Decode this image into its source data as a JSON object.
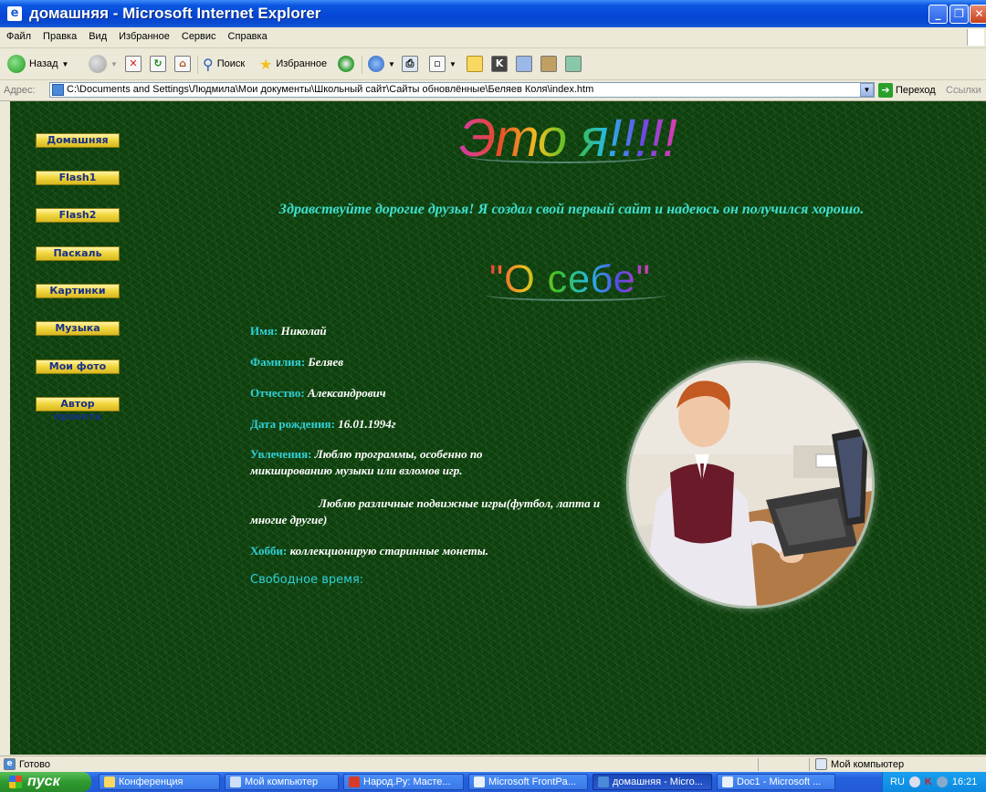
{
  "window": {
    "title": "домашняя - Microsoft Internet Explorer",
    "controls": [
      "minimize",
      "maximize",
      "close"
    ]
  },
  "menu": [
    "Файл",
    "Правка",
    "Вид",
    "Избранное",
    "Сервис",
    "Справка"
  ],
  "toolbar": {
    "back_label": "Назад",
    "search_label": "Поиск",
    "favorites_label": "Избранное"
  },
  "address": {
    "label": "Адрес:",
    "url": "C:\\Documents and Settings\\Людмила\\Мои документы\\Школьный сайт\\Сайты обновлённые\\Беляев Коля\\index.htm",
    "go_label": "Переход",
    "links_label": "Ссылки"
  },
  "page": {
    "nav": [
      "Домашняя",
      "Flash1",
      "Flash2",
      "Паскаль",
      "Картинки",
      "Музыка",
      "Мои фото",
      "Автор проекта"
    ],
    "heading": "Это я!!!!!",
    "greeting": "Здравствуйте дорогие друзья! Я создал свой первый сайт и надеюсь он получился хорошо.",
    "about_heading": "\"О себе\"",
    "fields": {
      "name_label": "Имя:",
      "name_value": "Николай",
      "surname_label": "Фамилия:",
      "surname_value": "Беляев",
      "patronymic_label": "Отчество:",
      "patronymic_value": "Александрович",
      "birth_label": "Дата рождения:",
      "birth_value": "16.01.1994г",
      "hobbies_label": "Увлечения:",
      "hobbies_value": "Люблю программы, особенно по микшированию музыки или взломов игр.",
      "hobbies_value2": "Люблю различные подвижные игры(футбол, лапта и многие другие)",
      "hobby_label": "Хобби:",
      "hobby_value": "коллекционирую старинные монеты.",
      "freetime_label": "Свободное время:"
    }
  },
  "status": {
    "left": "Готово",
    "zone": "Мой компьютер"
  },
  "taskbar": {
    "start_label": "пуск",
    "tasks": [
      "Конференция",
      "Мой компьютер",
      "Народ.Ру: Масте...",
      "Microsoft FrontPa...",
      "домашняя - Micro...",
      "Doc1 - Microsoft ..."
    ],
    "active_index": 4,
    "lang": "RU",
    "clock": "16:21"
  },
  "colors": {
    "page_background": "#10440f",
    "nav_button": "#f2d840",
    "nav_text": "#17308a",
    "field_label": "#30d0d8",
    "greeting": "#3fe0d0"
  }
}
